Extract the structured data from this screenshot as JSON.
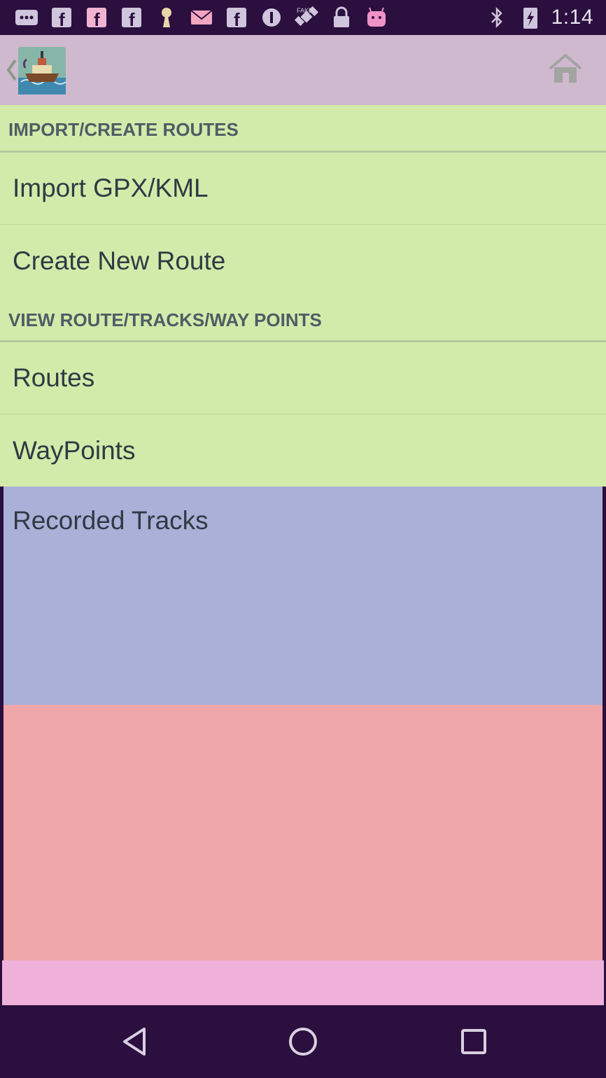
{
  "status_bar": {
    "time": "1:14",
    "icons_left": [
      "chat-icon",
      "facebook-icon",
      "facebook-icon",
      "facebook-icon",
      "keyhole-icon",
      "mail-icon",
      "facebook-icon",
      "info-circle-icon",
      "gps-satellite-icon",
      "lock-icon",
      "android-icon"
    ],
    "icons_right": [
      "bluetooth-icon",
      "charging-icon"
    ]
  },
  "toolbar": {
    "home_icon": "home-icon",
    "logo": "ship-logo"
  },
  "sections": {
    "import_header": "IMPORT/CREATE ROUTES",
    "import_items": [
      "Import GPX/KML",
      "Create New Route"
    ],
    "view_header": "VIEW ROUTE/TRACKS/WAY POINTS",
    "view_items": [
      "Routes",
      "WayPoints"
    ],
    "tracks_label": "Recorded Tracks"
  },
  "nav_bar": {
    "buttons": [
      "back-triangle-icon",
      "home-circle-icon",
      "recents-square-icon"
    ]
  },
  "colors": {
    "status_bg": "#2b0f3f",
    "toolbar_bg": "#cfb9cf",
    "list_bg": "#d3ebaa",
    "tracks_bg": "#abb0d8",
    "red_panel": "#eea6a8",
    "pink_panel": "#efb0da"
  }
}
